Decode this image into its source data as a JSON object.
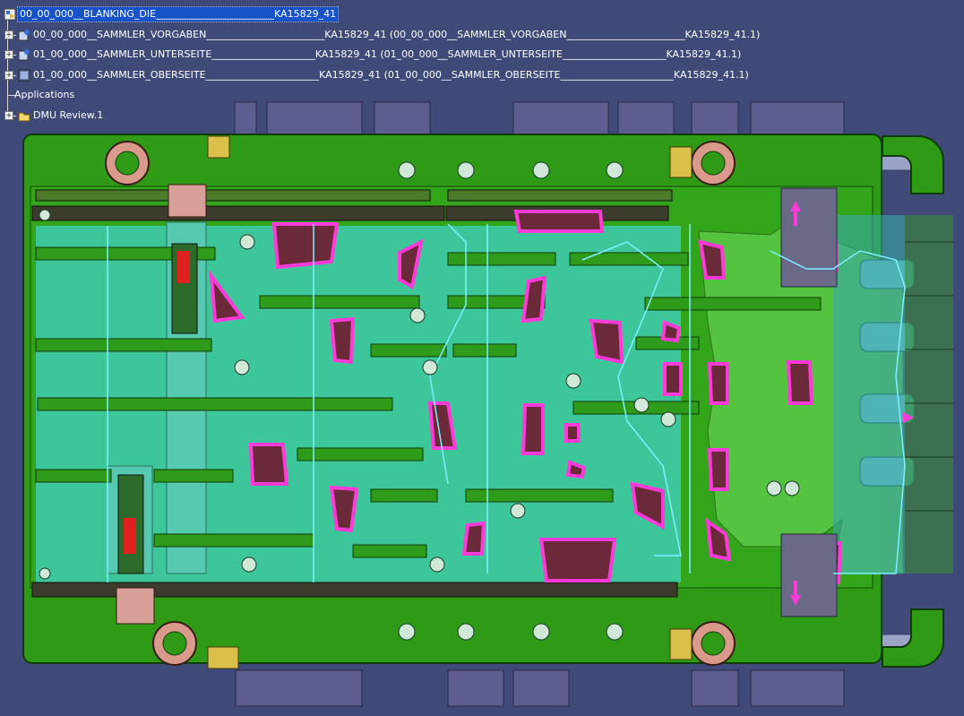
{
  "tree": {
    "root": {
      "label": "00_00_000__BLANKING_DIE________________________KA15829_41"
    },
    "children": [
      {
        "label": "00_00_000__SAMMLER_VORGABEN________________________KA15829_41 (00_00_000__SAMMLER_VORGABEN________________________KA15829_41.1)"
      },
      {
        "label": "01_00_000__SAMMLER_UNTERSEITE_____________________KA15829_41 (01_00_000__SAMMLER_UNTERSEITE_____________________KA15829_41.1)"
      },
      {
        "label": "01_00_000__SAMMLER_OBERSEITE_______________________KA15829_41 (01_00_000__SAMMLER_OBERSEITE_______________________KA15829_41.1)"
      }
    ],
    "applications": {
      "label": "Applications"
    },
    "dmu": {
      "label": "DMU Review.1"
    }
  },
  "icons": {
    "root": "assembly-root-icon",
    "child": "product-assembly-icon",
    "dmu": "folder-icon"
  },
  "colors": {
    "background": "#3f4a79",
    "base_plate": "#2e9a16",
    "base_plate_dark": "#1a5a0d",
    "insert_teal": "#3fc7a2",
    "profile_magenta": "#ff3ad9",
    "pocket": "#6b2a3a",
    "rail": "#2f9b1a",
    "rail_dark": "#3c3c2c",
    "guide_ring": "#d99a8c",
    "tab": "#5d5d8f",
    "outline_cyan": "#7df0ff",
    "bright_green_part": "#58c744",
    "highlight": "#1753c8"
  }
}
